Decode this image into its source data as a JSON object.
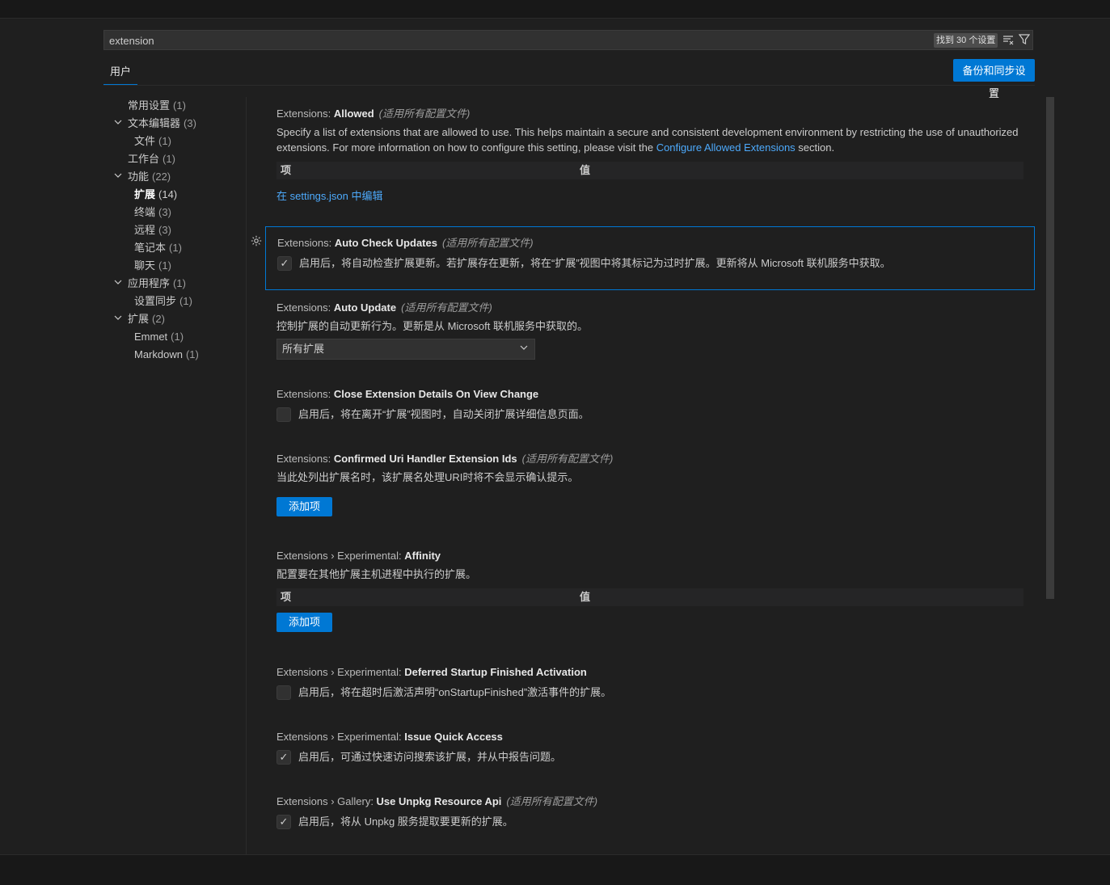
{
  "search": {
    "value": "extension",
    "result_count": "找到 30 个设置",
    "clear_filter_icon": "clear-filter-icon",
    "filter_icon": "filter-icon"
  },
  "tabs": {
    "user": "用户"
  },
  "sync_button": "备份和同步设置",
  "toc": {
    "items": [
      {
        "label": "常用设置",
        "count": "(1)"
      },
      {
        "label": "文本编辑器",
        "count": "(3)"
      },
      {
        "label": "文件",
        "count": "(1)"
      },
      {
        "label": "工作台",
        "count": "(1)"
      },
      {
        "label": "功能",
        "count": "(22)"
      },
      {
        "label": "扩展",
        "count": "(14)"
      },
      {
        "label": "终端",
        "count": "(3)"
      },
      {
        "label": "远程",
        "count": "(3)"
      },
      {
        "label": "笔记本",
        "count": "(1)"
      },
      {
        "label": "聊天",
        "count": "(1)"
      },
      {
        "label": "应用程序",
        "count": "(1)"
      },
      {
        "label": "设置同步",
        "count": "(1)"
      },
      {
        "label": "扩展",
        "count": "(2)"
      },
      {
        "label": "Emmet",
        "count": "(1)"
      },
      {
        "label": "Markdown",
        "count": "(1)"
      }
    ]
  },
  "settings": {
    "allowed": {
      "category": "Extensions: ",
      "key": "Allowed",
      "scope": "(适用所有配置文件)",
      "desc_before": "Specify a list of extensions that are allowed to use. This helps maintain a secure and consistent development environment by restricting the use of unauthorized extensions. For more information on how to configure this setting, please visit the ",
      "desc_link": "Configure Allowed Extensions",
      "desc_after": " section.",
      "col_item": "项",
      "col_value": "值",
      "edit_link": "在 settings.json 中编辑"
    },
    "auto_check_updates": {
      "category": "Extensions: ",
      "key": "Auto Check Updates",
      "scope": "(适用所有配置文件)",
      "checked": true,
      "text": "启用后，将自动检查扩展更新。若扩展存在更新，将在“扩展”视图中将其标记为过时扩展。更新将从 Microsoft 联机服务中获取。"
    },
    "auto_update": {
      "category": "Extensions: ",
      "key": "Auto Update",
      "scope": "(适用所有配置文件)",
      "desc": "控制扩展的自动更新行为。更新是从 Microsoft 联机服务中获取的。",
      "selected": "所有扩展"
    },
    "close_details": {
      "category": "Extensions: ",
      "key": "Close Extension Details On View Change",
      "checked": false,
      "text": "启用后，将在离开“扩展”视图时，自动关闭扩展详细信息页面。"
    },
    "confirmed_uri": {
      "category": "Extensions: ",
      "key": "Confirmed Uri Handler Extension Ids",
      "scope": "(适用所有配置文件)",
      "desc": "当此处列出扩展名时，该扩展名处理URI时将不会显示确认提示。",
      "add_button": "添加项"
    },
    "affinity": {
      "category": "Extensions › Experimental: ",
      "key": "Affinity",
      "desc": "配置要在其他扩展主机进程中执行的扩展。",
      "col_item": "项",
      "col_value": "值",
      "add_button": "添加项"
    },
    "deferred_startup": {
      "category": "Extensions › Experimental: ",
      "key": "Deferred Startup Finished Activation",
      "checked": false,
      "text": "启用后，将在超时后激活声明“onStartupFinished”激活事件的扩展。"
    },
    "issue_quick_access": {
      "category": "Extensions › Experimental: ",
      "key": "Issue Quick Access",
      "checked": true,
      "text": "启用后，可通过快速访问搜索该扩展，并从中报告问题。"
    },
    "unpkg": {
      "category": "Extensions › Gallery: ",
      "key": "Use Unpkg Resource Api",
      "scope": "(适用所有配置文件)",
      "checked": true,
      "text": "启用后，将从 Unpkg 服务提取要更新的扩展。"
    }
  },
  "colors": {
    "accent": "#0078d4",
    "link": "#4daafc",
    "background": "#1f1f1f"
  }
}
